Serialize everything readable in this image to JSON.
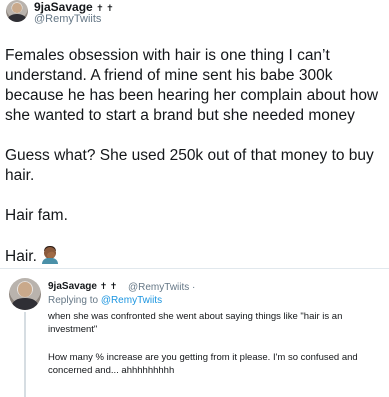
{
  "main_tweet": {
    "author_name": "9jaSavage",
    "author_symbols": "✝ ✝",
    "author_handle": "@RemyTwiits",
    "lines": [
      "Females obsession with hair is one thing I can’t",
      "understand. A friend of mine sent his babe 300k",
      "because he has been hearing her complain about how",
      "she wanted to start a brand but she needed money",
      "Guess what? She used 250k out of that money to buy",
      "hair.",
      "Hair fam.",
      "Hair."
    ],
    "emoji": "facepalm-icon"
  },
  "reply_tweet": {
    "author_name": "9jaSavage",
    "author_symbols": "✝ ✝",
    "author_handle": "@RemyTwiits ·",
    "replying_prefix": "Replying to",
    "replying_handle": "@RemyTwiits",
    "lines": [
      "when she was confronted she went about saying things like \"hair is an",
      "investment\"",
      "How many % increase are you getting from it please. I'm so confused and",
      "concerned and... ahhhhhhhhh"
    ]
  },
  "colors": {
    "text": "#14171a",
    "secondary": "#657786",
    "link": "#1b95e0",
    "divider": "#e1e8ed"
  }
}
